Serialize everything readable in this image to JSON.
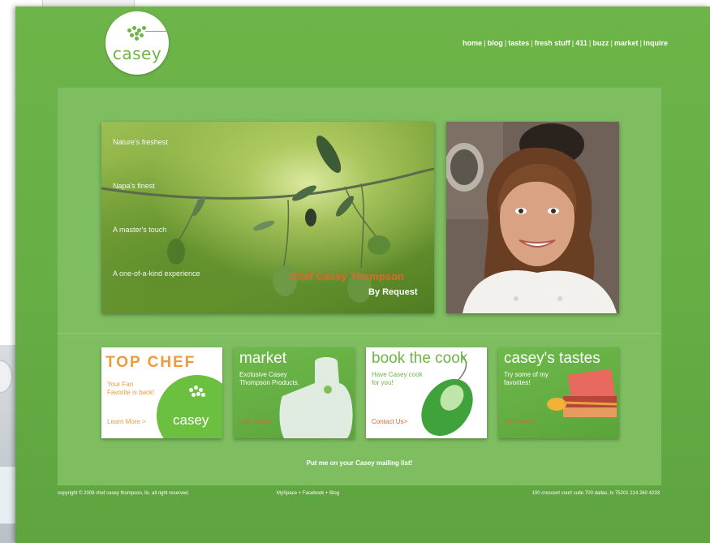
{
  "brand": {
    "logo_text": "casey"
  },
  "nav": {
    "items": [
      "home",
      "blog",
      "tastes",
      "fresh stuff",
      "411",
      "buzz",
      "market",
      "inquire"
    ],
    "separator": "|"
  },
  "hero": {
    "lines": [
      "Nature's freshest",
      "Napa's finest",
      "A master's touch",
      "A one-of-a-kind experience"
    ],
    "chef_name": "Chef Casey Thompson",
    "by_request": "By Request"
  },
  "cards": {
    "top_chef": {
      "title": "TOP CHEF",
      "desc": "Your Fan Favorite is back!",
      "cta": "Learn More >",
      "logo": "casey"
    },
    "market": {
      "title": "market",
      "desc": "Exclusive Casey Thompson Products.",
      "cta": "Lets Shop>"
    },
    "book": {
      "title": "book the cook",
      "desc": "Have Casey cook for you!",
      "cta": "Contact Us>"
    },
    "tastes": {
      "title": "casey's tastes",
      "desc": "Try some of my favorites!",
      "cta": "Try Them>"
    }
  },
  "mailing_list": "Put me on your Casey mailing list!",
  "footer": {
    "copyright": "copyright © 2008 chef casey thompson, llc. all right reserved.",
    "social": "MySpace + Facebook + Blog",
    "address": "100 crescent court suite 700 dallas, tx 75201 214 260 4233"
  },
  "colors": {
    "page_green": "#6db549",
    "panel_green": "#7fbd61",
    "accent_orange": "#e8632b",
    "top_chef_orange": "#f29a3a"
  }
}
